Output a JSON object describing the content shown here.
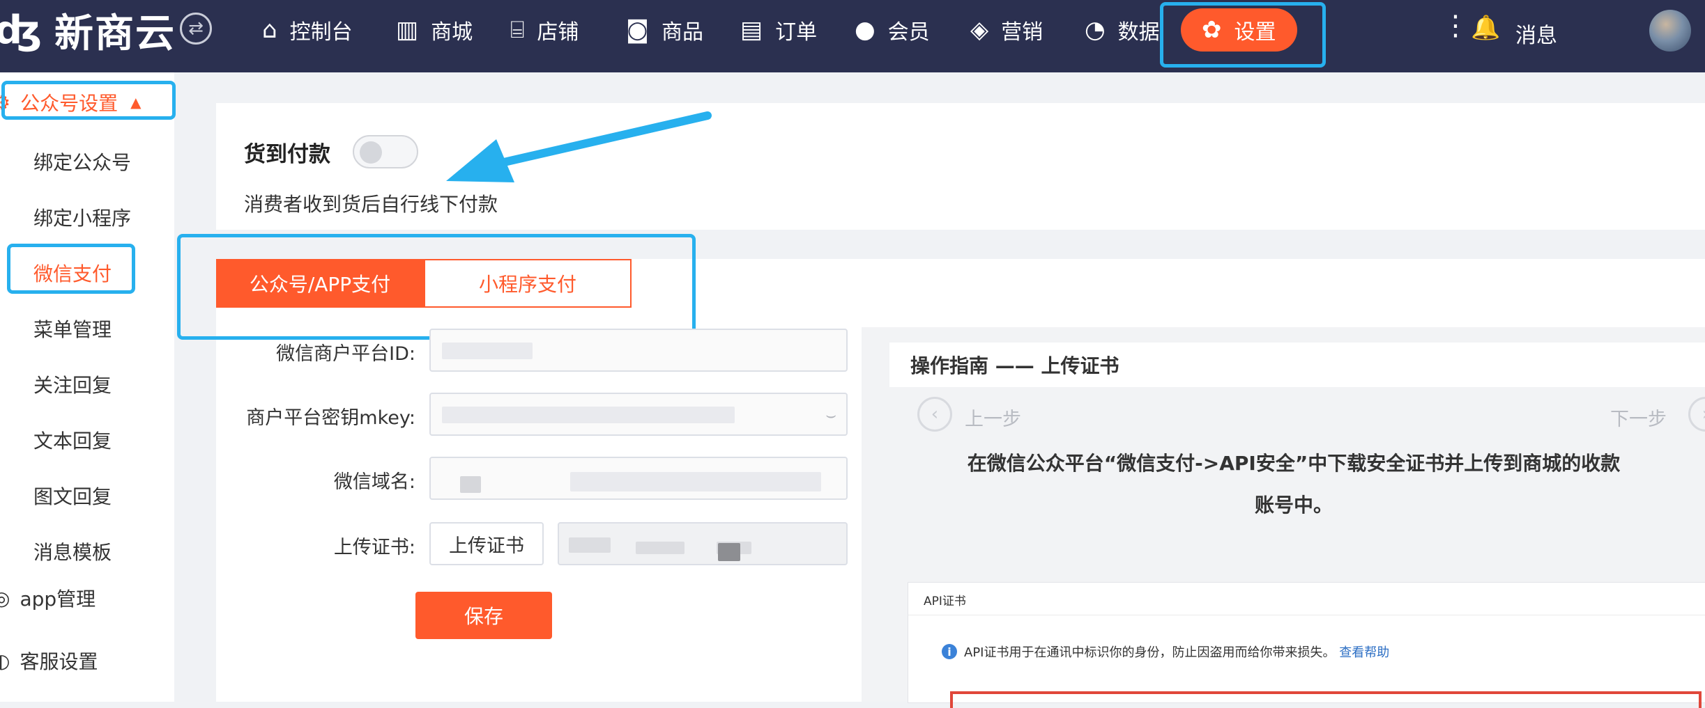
{
  "brand": {
    "logo_mark": "ʤ",
    "name": "新商云"
  },
  "nav": {
    "items": [
      {
        "label": "控制台",
        "icon": "home-icon",
        "glyph": "⌂"
      },
      {
        "label": "商城",
        "icon": "building-icon",
        "glyph": "▥"
      },
      {
        "label": "店铺",
        "icon": "store-icon",
        "glyph": "⌸"
      },
      {
        "label": "商品",
        "icon": "bag-icon",
        "glyph": "◙"
      },
      {
        "label": "订单",
        "icon": "clipboard-icon",
        "glyph": "▤"
      },
      {
        "label": "会员",
        "icon": "user-icon",
        "glyph": "●"
      },
      {
        "label": "营销",
        "icon": "box-icon",
        "glyph": "◈"
      },
      {
        "label": "数据",
        "icon": "pie-chart-icon",
        "glyph": "◔"
      }
    ],
    "active_label": "设置",
    "active_icon_glyph": "✿",
    "more_glyph": "⋮",
    "bell_glyph": "🔔",
    "messages_label": "消息",
    "switch_glyph": "⇄"
  },
  "sidebar": {
    "group_open": {
      "label": "公众号设置",
      "icon_glyph": "⚙",
      "caret": "▲"
    },
    "items": [
      "绑定公众号",
      "绑定小程序",
      "微信支付",
      "菜单管理",
      "关注回复",
      "文本回复",
      "图文回复",
      "消息模板"
    ],
    "active_item": "微信支付",
    "group_app": {
      "label": "app管理",
      "icon_glyph": "◎"
    },
    "group_service": {
      "label": "客服设置",
      "icon_glyph": "◐"
    }
  },
  "cod": {
    "title": "货到付款",
    "toggle_on": false,
    "description": "消费者收到货后自行线下付款"
  },
  "tabs": {
    "active": "公众号/APP支付",
    "inactive": "小程序支付"
  },
  "form": {
    "merchant_id_label": "微信商户平台ID:",
    "mkey_label": "商户平台密钥mkey:",
    "domain_label": "微信域名:",
    "cert_label": "上传证书:",
    "upload_button": "上传证书",
    "save_button": "保存",
    "eye_glyph": "⌣"
  },
  "guide": {
    "title": "操作指南 —— 上传证书",
    "prev": "上一步",
    "next": "下一步",
    "prev_glyph": "‹",
    "next_glyph": "›",
    "message": "在微信公众平台“微信支付->API安全”中下载安全证书并上传到商城的收款账号中。",
    "cert_card": {
      "title": "API证书",
      "info_glyph": "i",
      "info_text": "API证书用于在通讯中标识你的身份，防止因盗用而给你带来损失。",
      "help_link": "查看帮助"
    }
  },
  "colors": {
    "accent": "#ff5a2c",
    "nav_bg": "#2b3050",
    "annotation": "#27b0ee",
    "link": "#2d6fc4"
  }
}
